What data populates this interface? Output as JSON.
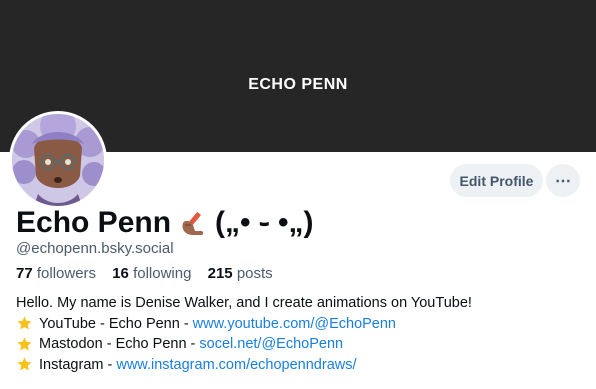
{
  "banner": {
    "title": "ECHO PENN"
  },
  "profile": {
    "display_name": "Echo Penn",
    "name_kaomoji": "(„• ֊ •„)",
    "handle": "@echopenn.bsky.social",
    "edit_button_label": "Edit Profile",
    "more_button_label": "⋯"
  },
  "stats": {
    "followers_count": "77",
    "followers_label": "followers",
    "following_count": "16",
    "following_label": "following",
    "posts_count": "215",
    "posts_label": "posts"
  },
  "bio": {
    "intro": "Hello. My name is Denise Walker, and I create animations on YouTube!",
    "links": [
      {
        "prefix": "YouTube - Echo Penn -",
        "url": "www.youtube.com/@EchoPenn"
      },
      {
        "prefix": "Mastodon - Echo Penn -",
        "url": "socel.net/@EchoPenn"
      },
      {
        "prefix": "Instagram -",
        "url": "www.instagram.com/echopenndraws/"
      }
    ],
    "bullet_icon": "star-icon"
  },
  "colors": {
    "banner": "#262626",
    "link": "#1a7ee0",
    "button_bg": "#eef1f4",
    "muted_text": "#4b5b6d"
  }
}
